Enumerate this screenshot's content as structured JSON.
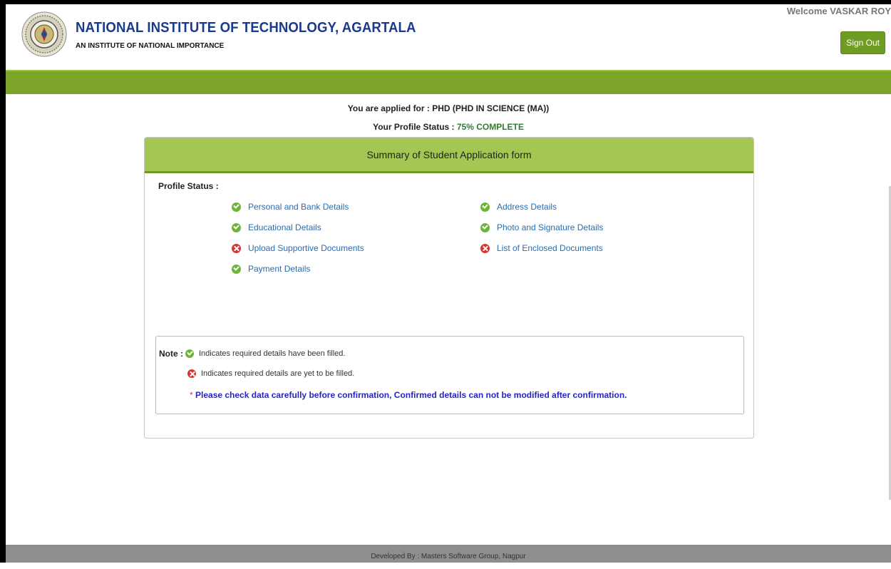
{
  "header": {
    "institute_name": "NATIONAL INSTITUTE OF TECHNOLOGY, AGARTALA",
    "tagline": "AN INSTITUTE OF NATIONAL IMPORTANCE",
    "welcome": "Welcome VASKAR ROY",
    "signout_label": "Sign Out",
    "logo_icon": "institute-seal-icon"
  },
  "applied": {
    "label": "You are applied for : ",
    "value": "PHD (PHD IN SCIENCE (MA))"
  },
  "profile": {
    "label": "Your Profile Status : ",
    "value": "75% COMPLETE",
    "progress": 0.75
  },
  "panel": {
    "title": "Summary of Student Application form",
    "status_label": "Profile Status :",
    "items": [
      {
        "label": "Personal and Bank Details",
        "status": "complete"
      },
      {
        "label": "Address Details",
        "status": "complete"
      },
      {
        "label": "Educational Details",
        "status": "complete"
      },
      {
        "label": "Photo and Signature Details",
        "status": "complete"
      },
      {
        "label": "Upload Supportive Documents",
        "status": "incomplete"
      },
      {
        "label": "List of Enclosed Documents",
        "status": "incomplete"
      },
      {
        "label": "Payment Details",
        "status": "complete"
      }
    ]
  },
  "note": {
    "label": "Note :",
    "filled_text": "Indicates required details have been filled.",
    "unfilled_text": "Indicates required details are yet to be filled.",
    "warning_star": "*",
    "warning": "Please check data carefully before confirmation, Confirmed details can not be modified after confirmation."
  },
  "footer": {
    "text": "Developed By : Masters Software Group, Nagpur"
  },
  "colors": {
    "header_bar": "#7ca429",
    "panel_header": "#a5c652",
    "complete_icon": "#6fb43a",
    "incomplete_icon": "#d63333",
    "link": "#2a6cb0",
    "warning": "#2424c8"
  }
}
